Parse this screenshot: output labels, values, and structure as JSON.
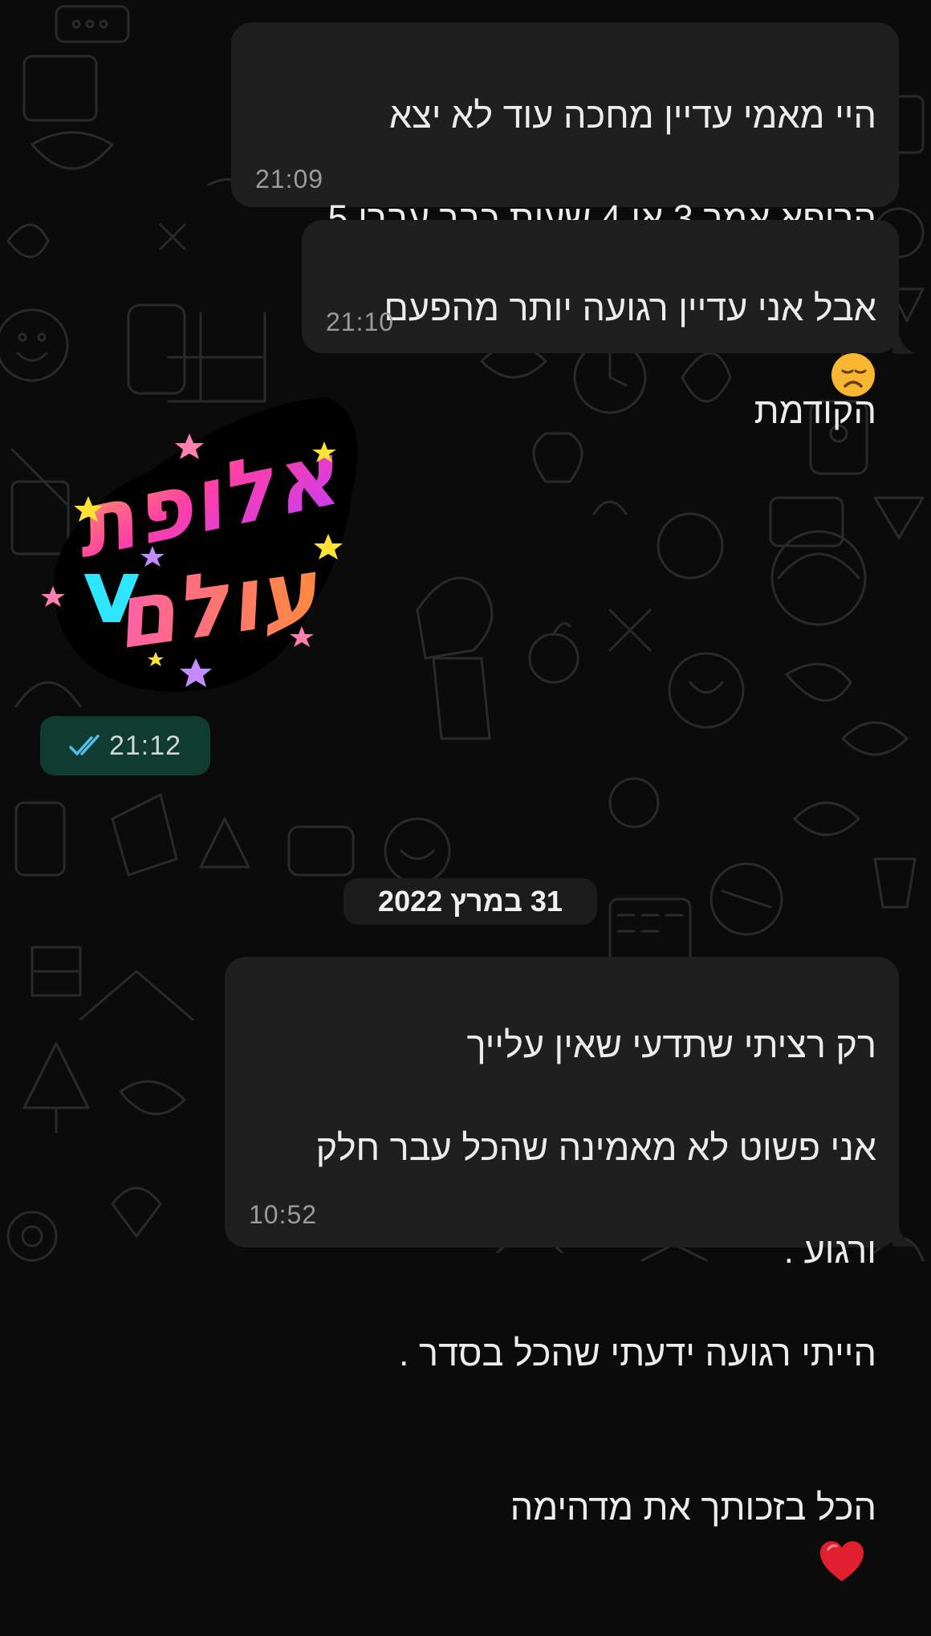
{
  "messages": [
    {
      "id": "msg1",
      "lines": [
        "היי מאמי עדיין מחכה עוד לא יצא",
        "הרופא אמר 3 או 4 שעות כבר עברו 5"
      ],
      "emoji": "disappointed-face-emoji",
      "time": "21:09"
    },
    {
      "id": "msg2",
      "lines": [
        "אבל אני עדיין רגועה יותר מהפעם",
        "הקודמת"
      ],
      "time": "21:10"
    },
    {
      "id": "msg4",
      "lines": [
        "רק רציתי שתדעי שאין עלייך",
        "אני פשוט לא מאמינה שהכל עבר חלק",
        "ורגוע .",
        "הייתי רגועה ידעתי שהכל בסדר .",
        "הכל בזכותך את מדהימה"
      ],
      "emoji": "red-heart-emoji",
      "time": "10:52"
    }
  ],
  "sticker": {
    "text_line1": "אלופת",
    "text_line2": "עולם",
    "heart_glyph": "v",
    "time": "21:12",
    "status_icon": "double-check-icon"
  },
  "date_separator": "31 במרץ 2022",
  "colors": {
    "background": "#0b0b0b",
    "incoming_bubble": "#1f1f1f",
    "outgoing_bubble": "#0f3b30",
    "read_check": "#53bdeb",
    "time_text": "#9c9c9c"
  }
}
